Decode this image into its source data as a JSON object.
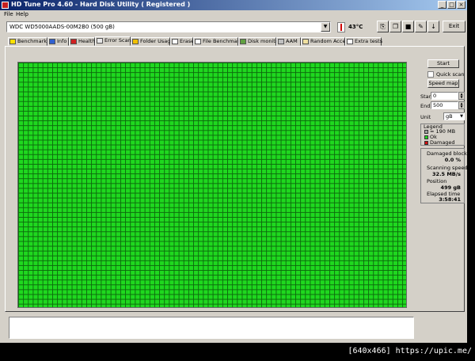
{
  "window": {
    "title": "HD Tune Pro 4.60 - Hard Disk Utility ( Registered )"
  },
  "menu": {
    "file": "File",
    "help": "Help"
  },
  "toolbar": {
    "drive": "WDC WD5000AADS-00M2B0    (500 gB)",
    "temperature": "43°C",
    "exit_label": "Exit",
    "buttons": [
      "copy-icon",
      "copy-all-icon",
      "save-icon",
      "options-icon",
      "download-icon"
    ]
  },
  "tabs": [
    {
      "label": "Benchmark",
      "icon": "benchmark-icon"
    },
    {
      "label": "Info",
      "icon": "info-icon"
    },
    {
      "label": "Health",
      "icon": "health-icon"
    },
    {
      "label": "Error Scan",
      "icon": "error-scan-icon"
    },
    {
      "label": "Folder Usage",
      "icon": "folder-icon"
    },
    {
      "label": "Erase",
      "icon": "erase-icon"
    },
    {
      "label": "File Benchmark",
      "icon": "file-benchmark-icon"
    },
    {
      "label": "Disk monitor",
      "icon": "disk-monitor-icon"
    },
    {
      "label": "AAM",
      "icon": "speaker-icon"
    },
    {
      "label": "Random Access",
      "icon": "random-access-icon"
    },
    {
      "label": "Extra tests",
      "icon": "extra-tests-icon"
    }
  ],
  "active_tab": "Error Scan",
  "scan_panel": {
    "start_button": "Start",
    "quick_scan_label": "Quick scan",
    "quick_scan_checked": false,
    "speed_map_button": "Speed map",
    "start_label": "Start",
    "start_value": "0",
    "end_label": "End",
    "end_value": "500",
    "unit_label": "Unit",
    "unit_value": "gB"
  },
  "legend": {
    "title": "Legend",
    "block_size": "= 190 MB",
    "ok": "Ok",
    "damaged": "Damaged",
    "colors": {
      "block": "#a0a0a0",
      "ok": "#1fd81f",
      "damaged": "#d01010"
    }
  },
  "stats": {
    "damaged_blocks_label": "Damaged blocks",
    "damaged_blocks_value": "0.0 %",
    "scanning_speed_label": "Scanning speed",
    "scanning_speed_value": "32.5 MB/s",
    "position_label": "Position",
    "position_value": "499 gB",
    "elapsed_label": "Elapsed time",
    "elapsed_value": "3:58:41"
  },
  "block_map": {
    "status": "all blocks ok",
    "color": "#1fd81f"
  },
  "watermark": "[640x466] https://upic.me/"
}
